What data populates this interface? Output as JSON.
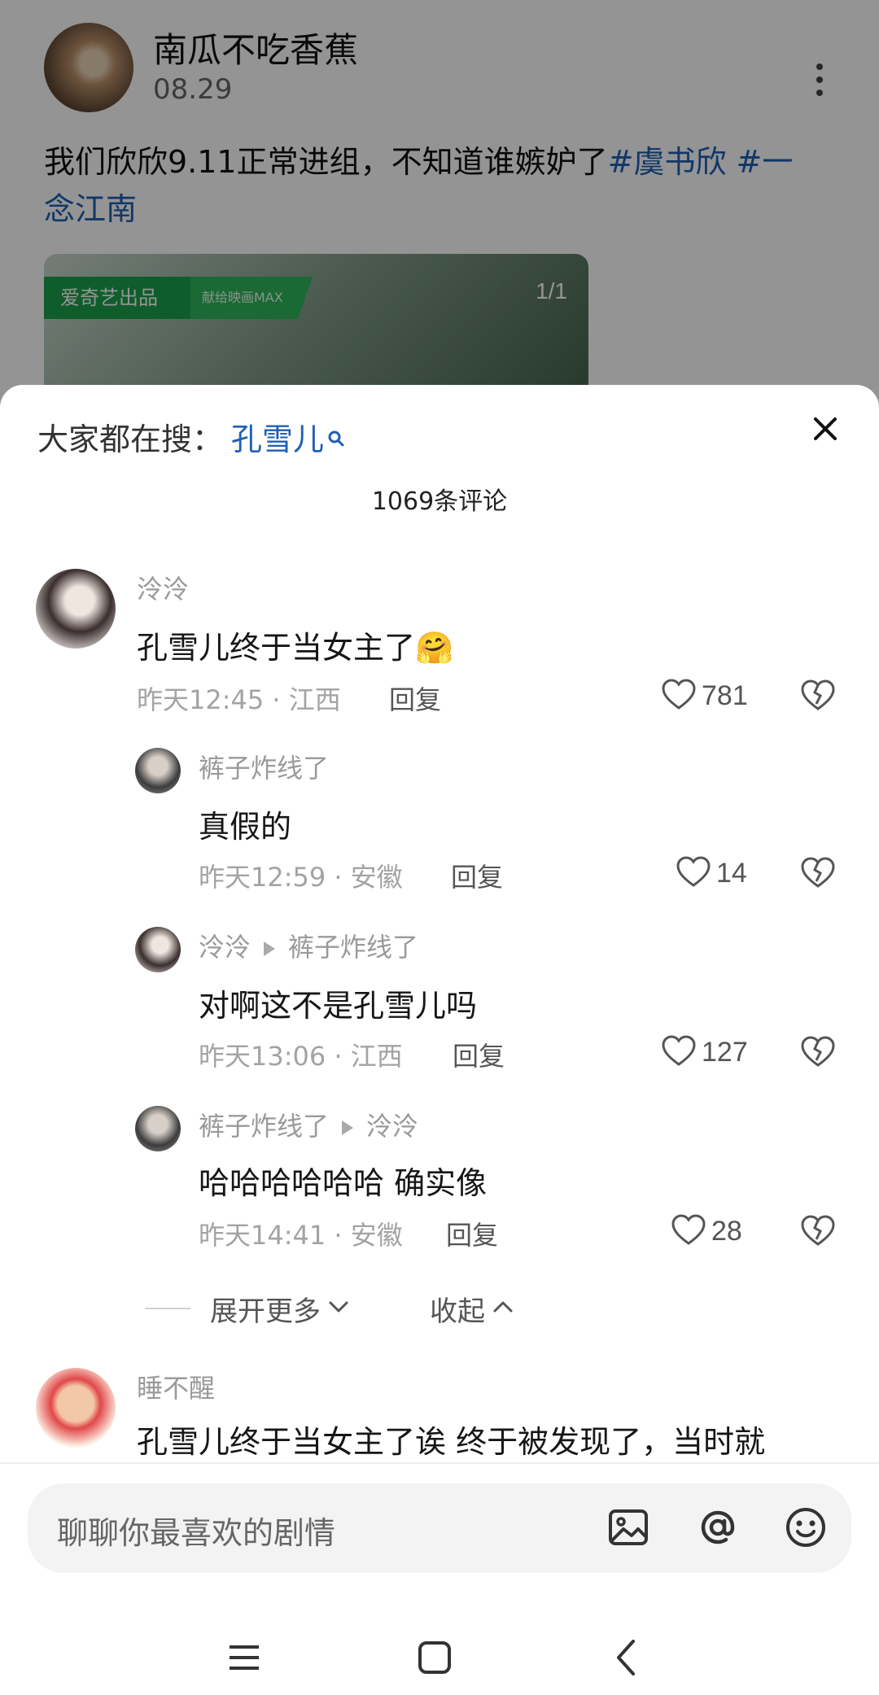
{
  "post": {
    "author": "南瓜不吃香蕉",
    "date": "08.29",
    "text_plain": "我们欣欣9.11正常进组，不知道谁嫉妒了",
    "tag1": "#虞书欣 #一",
    "tag2": "念江南",
    "media_badge": "爱奇艺出品",
    "media_badge2": "献给映画MAX",
    "media_count": "1/1"
  },
  "sheet": {
    "search_prefix": "大家都在搜：",
    "search_keyword": "孔雪儿",
    "comment_count_title": "1069条评论"
  },
  "comments": [
    {
      "name": "泠泠",
      "text": "孔雪儿终于当女主了🤗",
      "time": "昨天12:45 · 江西",
      "reply": "回复",
      "likes": "781"
    },
    {
      "name": "裤子炸线了",
      "text": "真假的",
      "time": "昨天12:59 · 安徽",
      "reply": "回复",
      "likes": "14"
    },
    {
      "name": "泠泠",
      "reply_to": "裤子炸线了",
      "text": "对啊这不是孔雪儿吗",
      "time": "昨天13:06 · 江西",
      "reply": "回复",
      "likes": "127"
    },
    {
      "name": "裤子炸线了",
      "reply_to": "泠泠",
      "text": "哈哈哈哈哈哈 确实像",
      "time": "昨天14:41 · 安徽",
      "reply": "回复",
      "likes": "28"
    },
    {
      "name": "睡不醒",
      "text": "孔雪儿终于当女主了诶 终于被发现了，当时就"
    }
  ],
  "thread_controls": {
    "expand_more": "展开更多",
    "collapse": "收起"
  },
  "input": {
    "placeholder": "聊聊你最喜欢的剧情"
  },
  "icons": {
    "more": "more-vertical-icon",
    "close": "close-icon",
    "like": "heart-outline-icon",
    "dislike": "broken-heart-icon",
    "image": "image-icon",
    "mention": "at-icon",
    "emoji": "emoji-icon",
    "nav_menu": "menu-icon",
    "nav_home": "home-square-icon",
    "nav_back": "back-icon"
  },
  "colors": {
    "link_blue": "#1e5fb3",
    "meta_gray": "#a3a3a3",
    "badge_green": "#1aa04a"
  }
}
